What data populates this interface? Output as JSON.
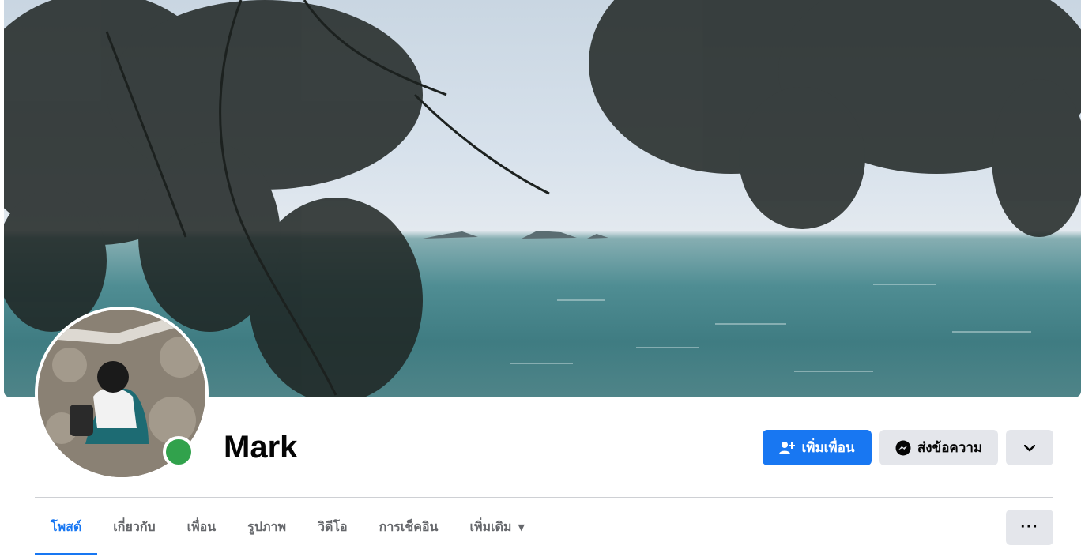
{
  "profile": {
    "name": "Mark",
    "online_status": "online",
    "status_color": "#31a24c"
  },
  "actions": {
    "add_friend_label": "เพิ่มเพื่อน",
    "add_friend_icon": "add-friend-icon",
    "message_label": "ส่งข้อความ",
    "message_icon": "messenger-icon",
    "more_icon": "chevron-down-icon"
  },
  "tabs": [
    {
      "label": "โพสต์",
      "active": true
    },
    {
      "label": "เกี่ยวกับ",
      "active": false
    },
    {
      "label": "เพื่อน",
      "active": false
    },
    {
      "label": "รูปภาพ",
      "active": false
    },
    {
      "label": "วิดีโอ",
      "active": false
    },
    {
      "label": "การเช็คอิน",
      "active": false
    },
    {
      "label": "เพิ่มเติม",
      "active": false,
      "dropdown": true
    }
  ],
  "tab_overflow_icon": "ellipsis-icon",
  "colors": {
    "accent": "#1877f2",
    "secondary_button": "#e4e6eb",
    "tab_text": "#65676b"
  }
}
